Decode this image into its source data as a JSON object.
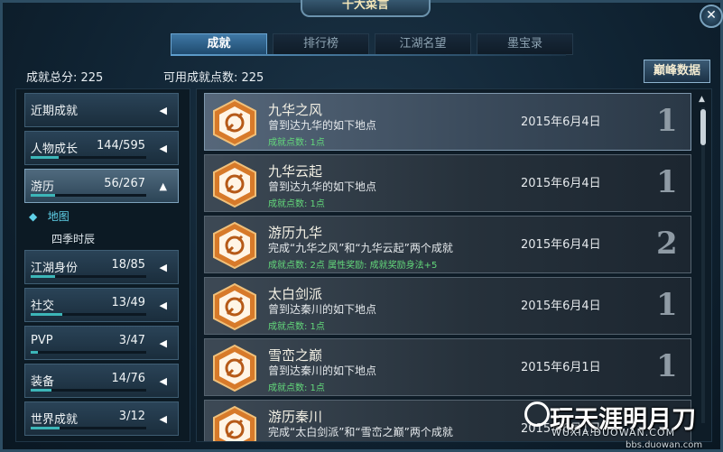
{
  "window": {
    "title": "十大菜言"
  },
  "tabs": [
    {
      "label": "成就",
      "active": true
    },
    {
      "label": "排行榜",
      "active": false
    },
    {
      "label": "江湖名望",
      "active": false
    },
    {
      "label": "墨宝录",
      "active": false
    }
  ],
  "summary": {
    "total_label": "成就总分: 225",
    "available_label": "可用成就点数: 225"
  },
  "peak_button": "巅峰数据",
  "categories": [
    {
      "label": "近期成就",
      "count": "",
      "progress": 0
    },
    {
      "label": "人物成长",
      "count": "144/595",
      "progress": 0.24
    },
    {
      "label": "游历",
      "count": "56/267",
      "progress": 0.21
    },
    {
      "label": "江湖身份",
      "count": "18/85",
      "progress": 0.21
    },
    {
      "label": "社交",
      "count": "13/49",
      "progress": 0.27
    },
    {
      "label": "PVP",
      "count": "3/47",
      "progress": 0.06
    },
    {
      "label": "装备",
      "count": "14/76",
      "progress": 0.18
    },
    {
      "label": "世界成就",
      "count": "3/12",
      "progress": 0.25
    }
  ],
  "subitems": [
    {
      "label": "地图",
      "active": true
    },
    {
      "label": "四季时辰",
      "active": false
    }
  ],
  "achievements": [
    {
      "name": "九华之风",
      "desc": "曾到达九华的如下地点",
      "points": "成就点数: 1点",
      "date": "2015年6月4日",
      "score": "1"
    },
    {
      "name": "九华云起",
      "desc": "曾到达九华的如下地点",
      "points": "成就点数: 1点",
      "date": "2015年6月4日",
      "score": "1"
    },
    {
      "name": "游历九华",
      "desc": "完成“九华之风”和“九华云起”两个成就",
      "points": "成就点数: 2点 属性奖励: 成就奖励身法+5",
      "date": "2015年6月4日",
      "score": "2"
    },
    {
      "name": "太白剑派",
      "desc": "曾到达秦川的如下地点",
      "points": "成就点数: 1点",
      "date": "2015年6月4日",
      "score": "1"
    },
    {
      "name": "雪峦之巅",
      "desc": "曾到达秦川的如下地点",
      "points": "成就点数: 1点",
      "date": "2015年6月1日",
      "score": "1"
    },
    {
      "name": "游历秦川",
      "desc": "完成“太白剑派”和“雪峦之巅”两个成就",
      "points": "",
      "date": "2015年6月1日",
      "score": ""
    }
  ],
  "watermark": {
    "text": "玩天涯明月刀",
    "url1": "WUXIA.DUOWAN.COM",
    "url2": "bbs.duowan.com"
  },
  "colors": {
    "accent": "#3f78a5",
    "progress": "#3cb6b8",
    "points_green": "#63d87b",
    "badge_orange": "#d77a2a"
  }
}
